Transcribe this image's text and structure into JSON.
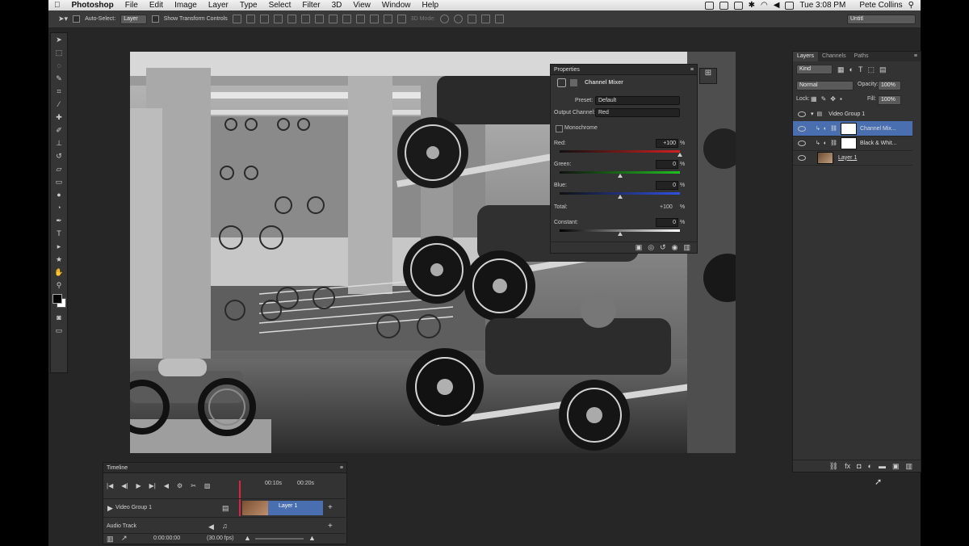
{
  "menubar": {
    "app": "Photoshop",
    "items": [
      "File",
      "Edit",
      "Image",
      "Layer",
      "Type",
      "Select",
      "Filter",
      "3D",
      "View",
      "Window",
      "Help"
    ],
    "clock": "Tue 3:08 PM",
    "user": "Pete Collins"
  },
  "options_bar": {
    "auto_select_label": "Auto-Select:",
    "auto_select_value": "Layer",
    "transform_label": "Show Transform Controls",
    "mode_3d": "3D Mode:",
    "workspace": "Untitl"
  },
  "properties": {
    "title": "Properties",
    "adjustment": "Channel Mixer",
    "preset_label": "Preset:",
    "preset_value": "Default",
    "output_label": "Output Channel:",
    "output_value": "Red",
    "monochrome_label": "Monochrome",
    "channels": [
      {
        "label": "Red:",
        "value": "+100",
        "unit": "%",
        "level": 1.0,
        "color": "#d02020"
      },
      {
        "label": "Green:",
        "value": "0",
        "unit": "%",
        "level": 0.5,
        "color": "#20c020"
      },
      {
        "label": "Blue:",
        "value": "0",
        "unit": "%",
        "level": 0.5,
        "color": "#3050e0"
      }
    ],
    "total_label": "Total:",
    "total_value": "+100",
    "total_unit": "%",
    "constant_label": "Constant:",
    "constant_value": "0",
    "constant_unit": "%",
    "constant_level": 0.5
  },
  "layers": {
    "tabs": [
      "Layers",
      "Channels",
      "Paths"
    ],
    "filter": "Kind",
    "blend": "Normal",
    "opacity_label": "Opacity:",
    "opacity": "100%",
    "lock_label": "Lock:",
    "fill_label": "Fill:",
    "fill": "100%",
    "rows": [
      {
        "name": "Video Group 1",
        "type": "group"
      },
      {
        "name": "Channel Mix...",
        "type": "adjustment",
        "selected": true
      },
      {
        "name": "Black & Whit...",
        "type": "adjustment"
      },
      {
        "name": "Layer 1",
        "type": "image"
      }
    ]
  },
  "timeline": {
    "title": "Timeline",
    "time1": "00:10s",
    "time2": "00:20s",
    "group": "Video Group 1",
    "clip": "Layer 1",
    "audio": "Audio Track",
    "timecode": "0:00:00:00",
    "fps": "(30.00 fps)"
  },
  "colors": {
    "accent": "#4a6fb0",
    "panel": "#333333",
    "bg": "#262626"
  }
}
